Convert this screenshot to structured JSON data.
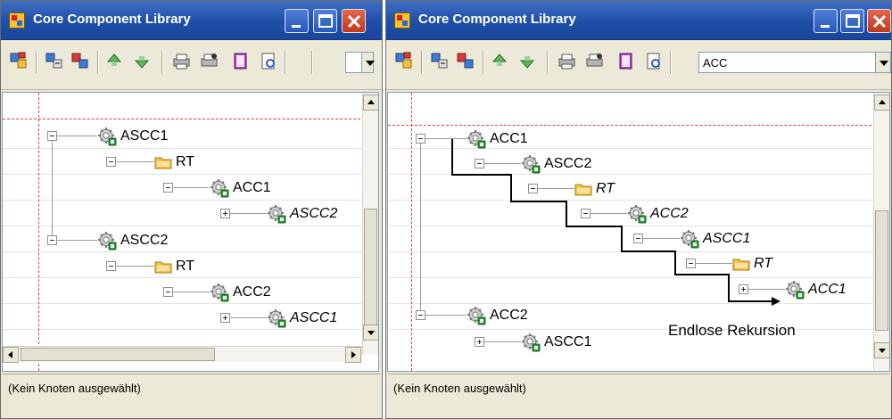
{
  "left_window": {
    "title": "Core Component Library",
    "combo_value": "",
    "status_text": "(Kein Knoten ausgewählt)",
    "tree": [
      {
        "label": "ASCC1",
        "italic": false,
        "icon": "gear-icon",
        "expander": "minus"
      },
      {
        "label": "RT",
        "italic": false,
        "icon": "folder-icon",
        "expander": "minus"
      },
      {
        "label": "ACC1",
        "italic": false,
        "icon": "gear-icon",
        "expander": "minus"
      },
      {
        "label": "ASCC2",
        "italic": true,
        "icon": "gear-icon",
        "expander": "plus"
      },
      {
        "label": "ASCC2",
        "italic": false,
        "icon": "gear-icon",
        "expander": "minus"
      },
      {
        "label": "RT",
        "italic": false,
        "icon": "folder-icon",
        "expander": "minus"
      },
      {
        "label": "ACC2",
        "italic": false,
        "icon": "gear-icon",
        "expander": "minus"
      },
      {
        "label": "ASCC1",
        "italic": true,
        "icon": "gear-icon",
        "expander": "plus"
      }
    ]
  },
  "right_window": {
    "title": "Core Component Library",
    "combo_value": "ACC",
    "status_text": "(Kein Knoten ausgewählt)",
    "annotation": "Endlose Rekursion",
    "tree": [
      {
        "label": "ACC1",
        "italic": false,
        "icon": "gear-icon",
        "expander": "minus"
      },
      {
        "label": "ASCC2",
        "italic": false,
        "icon": "gear-icon",
        "expander": "minus"
      },
      {
        "label": "RT",
        "italic": true,
        "icon": "folder-icon",
        "expander": "minus"
      },
      {
        "label": "ACC2",
        "italic": true,
        "icon": "gear-icon",
        "expander": "minus"
      },
      {
        "label": "ASCC1",
        "italic": true,
        "icon": "gear-icon",
        "expander": "minus"
      },
      {
        "label": "RT",
        "italic": true,
        "icon": "folder-icon",
        "expander": "minus"
      },
      {
        "label": "ACC1",
        "italic": true,
        "icon": "gear-icon",
        "expander": "plus"
      },
      {
        "label": "ACC2",
        "italic": false,
        "icon": "gear-icon",
        "expander": "minus"
      },
      {
        "label": "ASCC1",
        "italic": false,
        "icon": "gear-icon",
        "expander": "plus"
      }
    ]
  },
  "toolbar_icons": [
    "add-acc-icon",
    "add-ascc-icon",
    "add-rt-icon",
    "move-up-icon",
    "move-down-icon",
    "print-icon",
    "print-setup-icon",
    "book-icon",
    "preview-icon"
  ],
  "colors": {
    "titlebar": "#1e4fa8",
    "margin_line": "#e23c3c",
    "window_face": "#ece9d8"
  }
}
